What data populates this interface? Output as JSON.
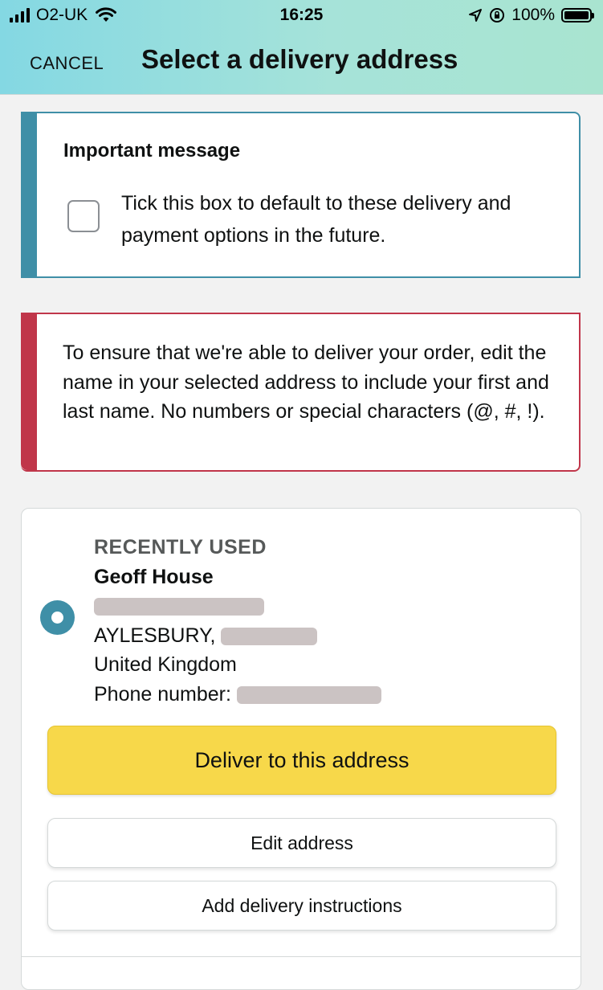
{
  "status_bar": {
    "carrier": "O2-UK",
    "time": "16:25",
    "battery": "100%"
  },
  "header": {
    "cancel_label": "CANCEL",
    "title": "Select a delivery address"
  },
  "important_message": {
    "heading": "Important message",
    "checkbox_label": "Tick this box to default to these delivery and payment options in the future.",
    "checked": false
  },
  "alert": {
    "text": "To ensure that we're able to deliver your order, edit the name in your selected address to include your first and last name. No numbers or special characters (@, #, !)."
  },
  "address": {
    "section_label": "RECENTLY USED",
    "name": "Geoff House",
    "town_prefix": "AYLESBURY,",
    "country": "United Kingdom",
    "phone_label": "Phone number:",
    "selected": true
  },
  "buttons": {
    "deliver": "Deliver to this address",
    "edit": "Edit address",
    "instructions": "Add delivery instructions"
  },
  "colors": {
    "accent_teal": "#3f8fa7",
    "alert_red": "#c0364a",
    "primary_button": "#f7d84a"
  }
}
